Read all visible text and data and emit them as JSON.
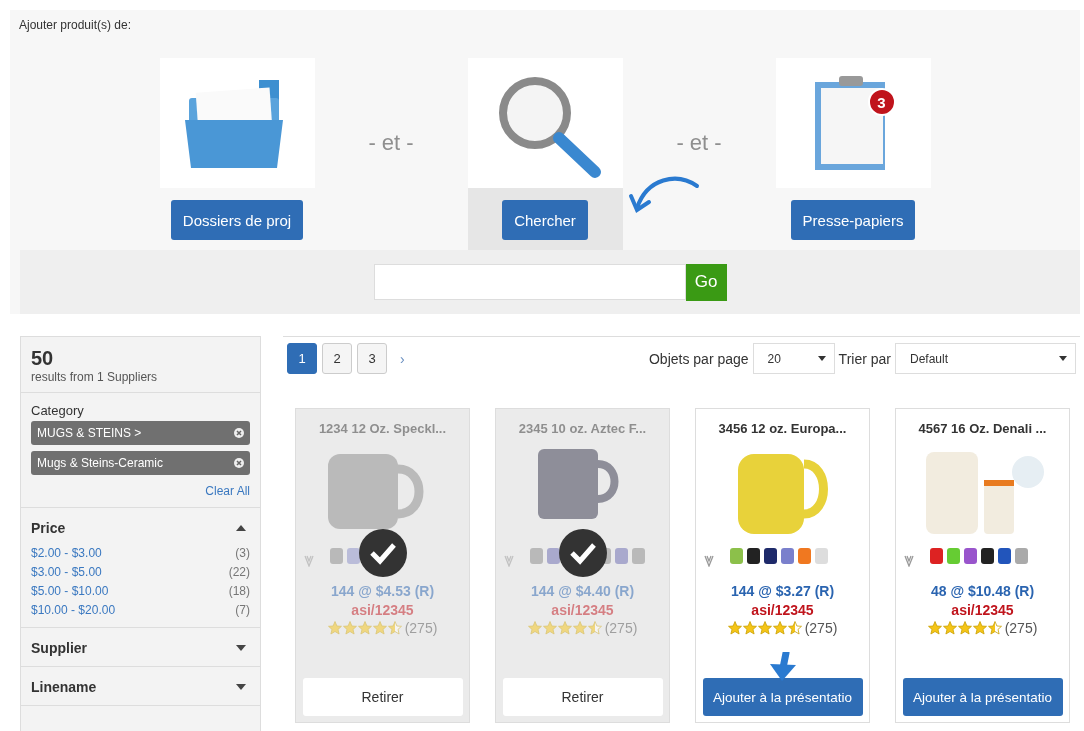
{
  "header": {
    "title": "Ajouter produit(s) de:"
  },
  "sources": [
    {
      "kind": "folder",
      "button": "Dossiers de proj",
      "selected": false
    },
    {
      "kind": "search",
      "button": "Chercher",
      "selected": true
    },
    {
      "kind": "clipboard",
      "button": "Presse-papiers",
      "selected": false,
      "badge": "3"
    }
  ],
  "separators": [
    "- et -",
    "- et -"
  ],
  "search": {
    "button": "Go"
  },
  "sidebar": {
    "count": "50",
    "subtitle": "results from 1 Suppliers",
    "category": {
      "label": "Category",
      "chips": [
        "MUGS & STEINS >",
        "Mugs & Steins-Ceramic"
      ],
      "clear": "Clear All"
    },
    "sections": [
      {
        "title": "Price",
        "expanded": true,
        "items": [
          {
            "label": "$2.00 - $3.00",
            "count": "(3)"
          },
          {
            "label": "$3.00 - $5.00",
            "count": "(22)"
          },
          {
            "label": "$5.00 - $10.00",
            "count": "(18)"
          },
          {
            "label": "$10.00 - $20.00",
            "count": "(7)"
          }
        ]
      },
      {
        "title": "Supplier",
        "expanded": false
      },
      {
        "title": "Linename",
        "expanded": false
      }
    ]
  },
  "pagination": {
    "pages": [
      {
        "label": "1",
        "selected": true
      },
      {
        "label": "2",
        "selected": false
      },
      {
        "label": "3",
        "selected": false
      }
    ],
    "next": "›"
  },
  "per_page": {
    "label": "Objets par page",
    "value": "20"
  },
  "sort": {
    "label": "Trier par",
    "value": "Default"
  },
  "products": [
    {
      "title": "1234  12 Oz. Speckl...",
      "price": "144 @ $4.53 (R)",
      "code": "asi/12345",
      "stars": 4.5,
      "reviews": "(275)",
      "selected": true,
      "button": "Retirer"
    },
    {
      "title": "2345  10 oz. Aztec F...",
      "price": "144 @ $4.40 (R)",
      "code": "asi/12345",
      "stars": 4.5,
      "reviews": "(275)",
      "selected": true,
      "button": "Retirer"
    },
    {
      "title": "3456  12 oz. Europa...",
      "price": "144 @ $3.27 (R)",
      "code": "asi/12345",
      "stars": 4.5,
      "reviews": "(275)",
      "selected": false,
      "button": "Ajouter à la présentatio"
    },
    {
      "title": "4567  16 Oz. Denali ...",
      "price": "48 @ $10.48 (R)",
      "code": "asi/12345",
      "stars": 4.5,
      "reviews": "(275)",
      "selected": false,
      "button": "Ajouter à la présentatio"
    }
  ]
}
